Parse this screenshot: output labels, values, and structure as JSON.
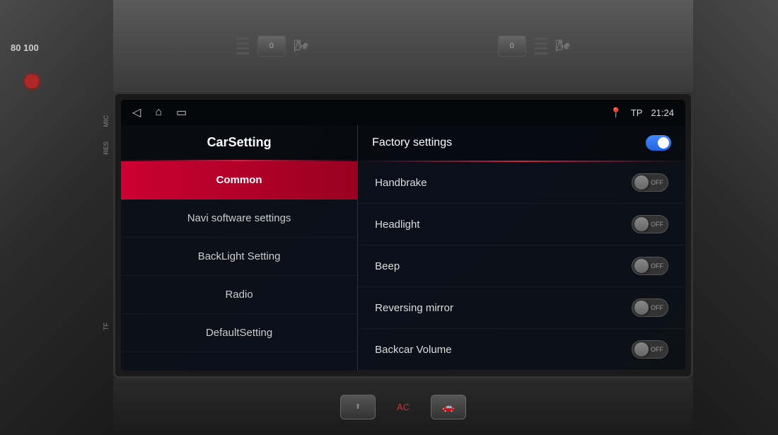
{
  "car": {
    "background_color": "#2a2a2a"
  },
  "status_bar": {
    "time": "21:24",
    "location_text": "TP",
    "pin_icon": "📍",
    "nav_back": "◁",
    "nav_home": "⌂",
    "nav_recent": "▭"
  },
  "left_panel": {
    "header": "CarSetting",
    "menu_items": [
      {
        "id": "common",
        "label": "Common",
        "active": true
      },
      {
        "id": "navi",
        "label": "Navi software settings",
        "active": false
      },
      {
        "id": "backlight",
        "label": "BackLight Setting",
        "active": false
      },
      {
        "id": "radio",
        "label": "Radio",
        "active": false
      },
      {
        "id": "default",
        "label": "DefaultSetting",
        "active": false
      }
    ]
  },
  "right_panel": {
    "header": "Factory settings",
    "factory_toggle_state": "on",
    "settings": [
      {
        "id": "handbrake",
        "label": "Handbrake",
        "state": "OFF"
      },
      {
        "id": "headlight",
        "label": "Headlight",
        "state": "OFF"
      },
      {
        "id": "beep",
        "label": "Beep",
        "state": "OFF"
      },
      {
        "id": "reversing_mirror",
        "label": "Reversing mirror",
        "state": "OFF"
      },
      {
        "id": "backcar_volume",
        "label": "Backcar Volume",
        "state": "OFF"
      }
    ]
  },
  "bottom_bar": {
    "ac_label": "AC",
    "btn1": "0",
    "btn2": "0"
  },
  "side_labels": {
    "mic": "MIC",
    "res": "RES",
    "tf": "TF"
  }
}
